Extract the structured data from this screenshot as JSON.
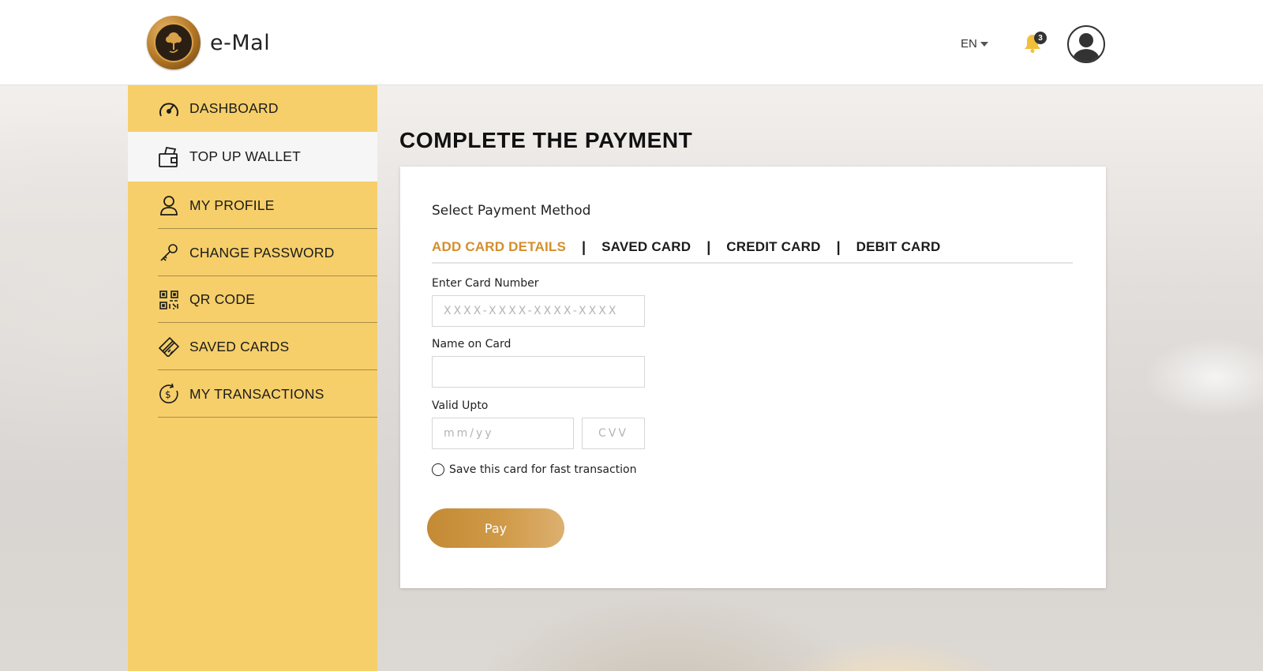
{
  "header": {
    "app_name": "e-Mal",
    "language": "EN",
    "notification_count": "3"
  },
  "sidebar": {
    "items": [
      {
        "label": "DASHBOARD",
        "icon": "speedometer-icon",
        "active": false
      },
      {
        "label": "TOP UP WALLET",
        "icon": "wallet-icon",
        "active": true
      },
      {
        "label": "MY PROFILE",
        "icon": "user-icon",
        "active": false
      },
      {
        "label": "CHANGE PASSWORD",
        "icon": "key-icon",
        "active": false
      },
      {
        "label": "QR CODE",
        "icon": "qr-code-icon",
        "active": false
      },
      {
        "label": "SAVED CARDS",
        "icon": "card-icon",
        "active": false
      },
      {
        "label": "MY TRANSACTIONS",
        "icon": "dollar-cycle-icon",
        "active": false
      }
    ]
  },
  "main": {
    "title": "COMPLETE THE PAYMENT",
    "select_method_label": "Select Payment Method",
    "tabs": [
      {
        "label": "ADD CARD DETAILS",
        "active": true
      },
      {
        "label": "SAVED CARD",
        "active": false
      },
      {
        "label": "CREDIT CARD",
        "active": false
      },
      {
        "label": "DEBIT CARD",
        "active": false
      }
    ],
    "tab_separator": "|",
    "card_number": {
      "label": "Enter Card Number",
      "placeholder": "XXXX-XXXX-XXXX-XXXX",
      "value": ""
    },
    "name_on_card": {
      "label": "Name on Card",
      "placeholder": "",
      "value": ""
    },
    "valid_upto": {
      "label": "Valid Upto",
      "placeholder": "mm/yy",
      "value": ""
    },
    "cvv": {
      "placeholder": "CVV",
      "value": ""
    },
    "save_card_label": "Save this card for fast transaction",
    "pay_label": "Pay"
  },
  "colors": {
    "sidebar_bg": "#f6cf6a",
    "active_tab": "#d48e2c",
    "pay_button": "#c48a34"
  }
}
